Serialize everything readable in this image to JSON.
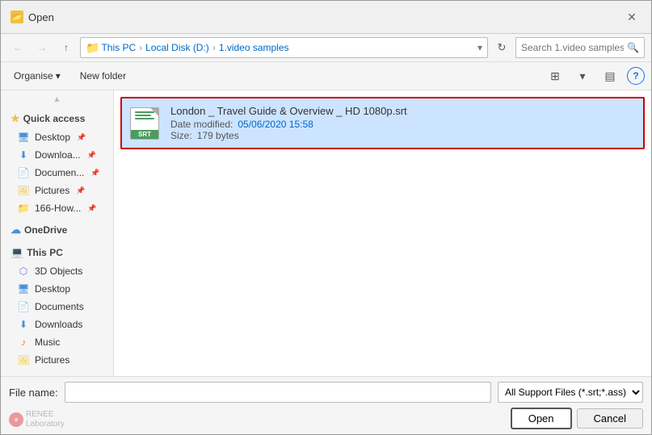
{
  "dialog": {
    "title": "Open",
    "close_label": "✕"
  },
  "nav": {
    "back_label": "←",
    "forward_label": "→",
    "up_label": "↑",
    "breadcrumb": {
      "parts": [
        "This PC",
        "Local Disk (D:)",
        "1.video samples"
      ],
      "separator": "›"
    },
    "refresh_label": "↻",
    "search_placeholder": "Search 1.video samples",
    "search_icon": "🔍"
  },
  "toolbar": {
    "organise_label": "Organise",
    "organise_arrow": "▾",
    "new_folder_label": "New folder",
    "view_icon": "☰",
    "view_options_icon": "▾",
    "pane_icon": "▤",
    "help_icon": "?"
  },
  "sidebar": {
    "quick_access_label": "Quick access",
    "quick_access_icon": "★",
    "items": [
      {
        "name": "Desktop",
        "icon": "desktop",
        "pinned": true
      },
      {
        "name": "Downloa...",
        "icon": "download",
        "pinned": true
      },
      {
        "name": "Documen...",
        "icon": "documents",
        "pinned": true
      },
      {
        "name": "Pictures",
        "icon": "pictures",
        "pinned": true
      },
      {
        "name": "166-How...",
        "icon": "folder",
        "pinned": true
      }
    ],
    "onedrive_label": "OneDrive",
    "thispc_label": "This PC",
    "thispc_items": [
      {
        "name": "3D Objects",
        "icon": "3d"
      },
      {
        "name": "Desktop",
        "icon": "desktop"
      },
      {
        "name": "Documents",
        "icon": "documents"
      },
      {
        "name": "Downloads",
        "icon": "download"
      },
      {
        "name": "Music",
        "icon": "music"
      },
      {
        "name": "Pictures",
        "icon": "pictures"
      }
    ]
  },
  "files": [
    {
      "name": "London _ Travel Guide & Overview _ HD 1080p.srt",
      "type": "srt",
      "date_label": "Date modified:",
      "date_value": "05/06/2020 15:58",
      "size_label": "Size:",
      "size_value": "179 bytes",
      "selected": true
    }
  ],
  "bottom": {
    "filename_label": "File name:",
    "filename_value": "",
    "filetype_label": "All Support Files (*.srt;*.ass)",
    "open_label": "Open",
    "cancel_label": "Cancel"
  },
  "watermark": {
    "brand": "RENEE",
    "sub": "Laboratory",
    "icon_label": "+"
  }
}
